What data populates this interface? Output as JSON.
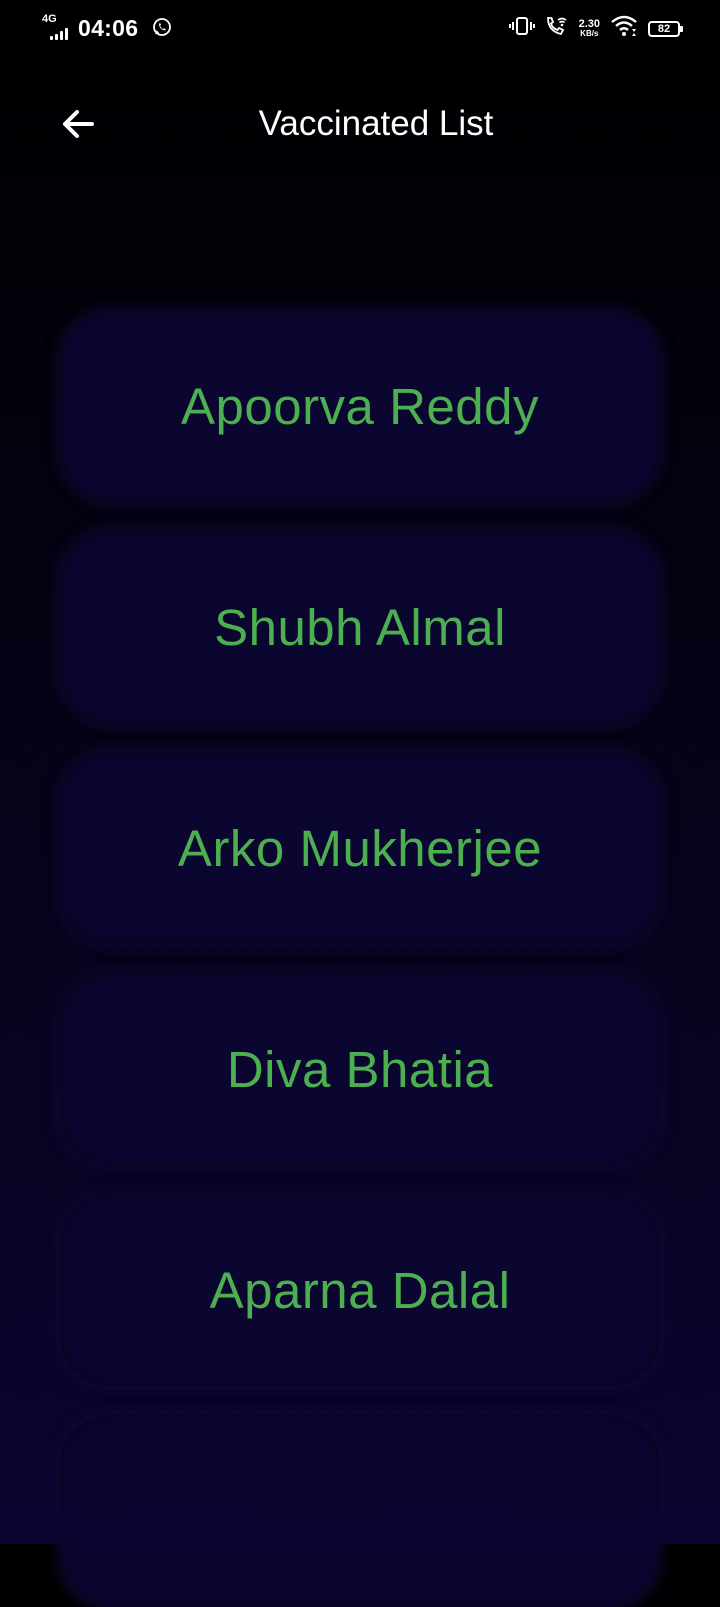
{
  "status_bar": {
    "network_type": "4G",
    "time": "04:06",
    "data_speed_value": "2.30",
    "data_speed_unit": "KB/s",
    "battery_level": "82",
    "icons": [
      "signal-icon",
      "whatsapp-icon",
      "vibrate-icon",
      "wifi-calling-icon",
      "wifi-icon",
      "battery-icon"
    ]
  },
  "app_bar": {
    "title": "Vaccinated List",
    "back_icon": "arrow-left-icon"
  },
  "vaccinated_list": {
    "accent_color": "#4caf50",
    "card_color": "#0b0630",
    "items": [
      {
        "name": "Apoorva Reddy"
      },
      {
        "name": "Shubh Almal"
      },
      {
        "name": "Arko Mukherjee"
      },
      {
        "name": "Diva Bhatia"
      },
      {
        "name": "Aparna Dalal"
      },
      {
        "name": ""
      }
    ]
  }
}
